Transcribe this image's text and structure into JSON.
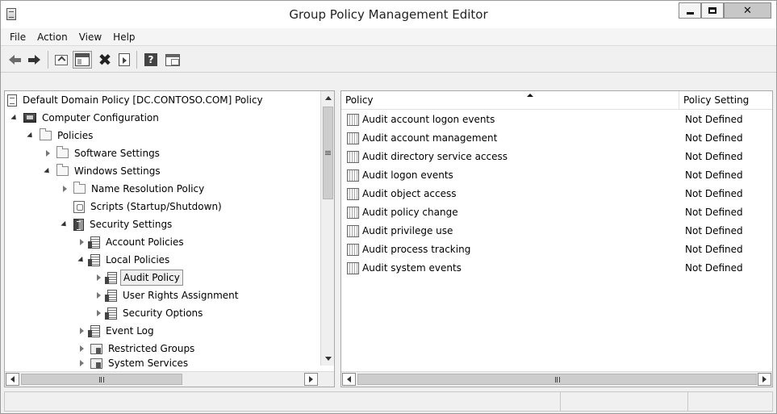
{
  "window": {
    "title": "Group Policy Management Editor"
  },
  "menu": [
    "File",
    "Action",
    "View",
    "Help"
  ],
  "toolbar": {
    "icons": [
      "back-arrow-icon",
      "forward-arrow-icon",
      "up-level-icon",
      "show-hide-console-tree-icon",
      "delete-icon",
      "export-list-icon",
      "help-icon",
      "properties-icon"
    ]
  },
  "tree": {
    "items": [
      {
        "label": "Default Domain Policy [DC.CONTOSO.COM] Policy",
        "icon": "policy-document-icon",
        "expander": "none",
        "level": 0
      },
      {
        "label": "Computer Configuration",
        "icon": "computer-icon",
        "expander": "open",
        "level": 1
      },
      {
        "label": "Policies",
        "icon": "folder-icon",
        "expander": "open",
        "level": 2
      },
      {
        "label": "Software Settings",
        "icon": "folder-icon",
        "expander": "collapsed",
        "level": 3
      },
      {
        "label": "Windows Settings",
        "icon": "folder-icon",
        "expander": "open",
        "level": 3
      },
      {
        "label": "Name Resolution Policy",
        "icon": "folder-icon",
        "expander": "collapsed",
        "level": 4
      },
      {
        "label": "Scripts (Startup/Shutdown)",
        "icon": "script-icon",
        "expander": "none",
        "level": 4
      },
      {
        "label": "Security Settings",
        "icon": "security-settings-icon",
        "expander": "open",
        "level": 4
      },
      {
        "label": "Account Policies",
        "icon": "policy-icon",
        "expander": "collapsed",
        "level": 5
      },
      {
        "label": "Local Policies",
        "icon": "policy-icon",
        "expander": "open",
        "level": 5
      },
      {
        "label": "Audit Policy",
        "icon": "policy-icon",
        "expander": "collapsed",
        "level": 6,
        "selected": true
      },
      {
        "label": "User Rights Assignment",
        "icon": "policy-icon",
        "expander": "collapsed",
        "level": 6
      },
      {
        "label": "Security Options",
        "icon": "policy-icon",
        "expander": "collapsed",
        "level": 6
      },
      {
        "label": "Event Log",
        "icon": "policy-icon",
        "expander": "collapsed",
        "level": 5
      },
      {
        "label": "Restricted Groups",
        "icon": "restricted-groups-icon",
        "expander": "collapsed",
        "level": 5
      },
      {
        "label": "System Services",
        "icon": "restricted-groups-icon",
        "expander": "collapsed",
        "level": 5
      }
    ]
  },
  "list": {
    "columns": [
      "Policy",
      "Policy Setting"
    ],
    "sorted_column": "Policy",
    "rows": [
      {
        "policy": "Audit account logon events",
        "setting": "Not Defined"
      },
      {
        "policy": "Audit account management",
        "setting": "Not Defined"
      },
      {
        "policy": "Audit directory service access",
        "setting": "Not Defined"
      },
      {
        "policy": "Audit logon events",
        "setting": "Not Defined"
      },
      {
        "policy": "Audit object access",
        "setting": "Not Defined"
      },
      {
        "policy": "Audit policy change",
        "setting": "Not Defined"
      },
      {
        "policy": "Audit privilege use",
        "setting": "Not Defined"
      },
      {
        "policy": "Audit process tracking",
        "setting": "Not Defined"
      },
      {
        "policy": "Audit system events",
        "setting": "Not Defined"
      }
    ]
  },
  "statusbar": {
    "text": ""
  }
}
